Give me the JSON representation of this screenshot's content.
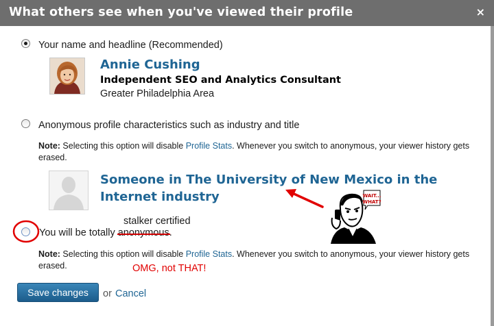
{
  "dialog": {
    "title": "What others see when you've viewed their profile",
    "close_label": "×"
  },
  "option1": {
    "label": "Your name and headline (Recommended)",
    "selected": true,
    "profile": {
      "name": "Annie Cushing",
      "headline": "Independent SEO and Analytics Consultant",
      "location": "Greater Philadelphia Area"
    }
  },
  "option2": {
    "label": "Anonymous profile characteristics such as industry and title",
    "selected": false,
    "note_prefix": "Note:",
    "note_before_link": " Selecting this option will disable ",
    "note_link": "Profile Stats",
    "note_after_link": ". Whenever you switch to anonymous, your viewer history gets erased.",
    "preview_name": "Someone in The University of New Mexico in the Internet industry"
  },
  "option3": {
    "label_before": "You will be totally ",
    "label_struck": "anonymous",
    "label_after": ".",
    "selected": false,
    "note_prefix": "Note:",
    "note_before_link": " Selecting this option will disable ",
    "note_link": "Profile Stats",
    "note_after_link": ". Whenever you switch to anonymous, your viewer history gets erased."
  },
  "annotations": {
    "stalker": "stalker certified",
    "omg": "OMG, not THAT!",
    "bubble_line1": "WAIT...",
    "bubble_line2": "WHAT?"
  },
  "footer": {
    "save_label": "Save changes",
    "or_text": "or",
    "cancel_label": "Cancel"
  },
  "colors": {
    "title_bar": "#6e6e6e",
    "link_blue": "#1f6594",
    "annotation_red": "#e10000",
    "button_blue": "#2a73a6"
  }
}
